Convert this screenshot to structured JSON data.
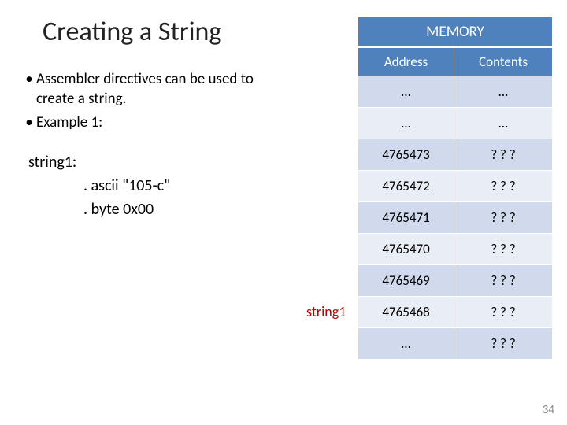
{
  "title": "Creating a String",
  "bullets": [
    "Assembler directives can be used to create a string.",
    "Example 1:"
  ],
  "code": {
    "label": "string1:",
    "line_ascii": ". ascii \"105-c\"",
    "line_byte": ". byte 0x00"
  },
  "memory": {
    "title": "MEMORY",
    "headers": {
      "addr": "Address",
      "cont": "Contents"
    },
    "rows": [
      {
        "addr": "…",
        "cont": "…"
      },
      {
        "addr": "…",
        "cont": "…"
      },
      {
        "addr": "4765473",
        "cont": "? ? ?"
      },
      {
        "addr": "4765472",
        "cont": "? ? ?"
      },
      {
        "addr": "4765471",
        "cont": "? ? ?"
      },
      {
        "addr": "4765470",
        "cont": "? ? ?"
      },
      {
        "addr": "4765469",
        "cont": "? ? ?"
      },
      {
        "addr": "4765468",
        "cont": "? ? ?"
      },
      {
        "addr": "…",
        "cont": "? ? ?"
      }
    ],
    "row_label": "string1",
    "row_label_index": 7
  },
  "page_number": "34"
}
